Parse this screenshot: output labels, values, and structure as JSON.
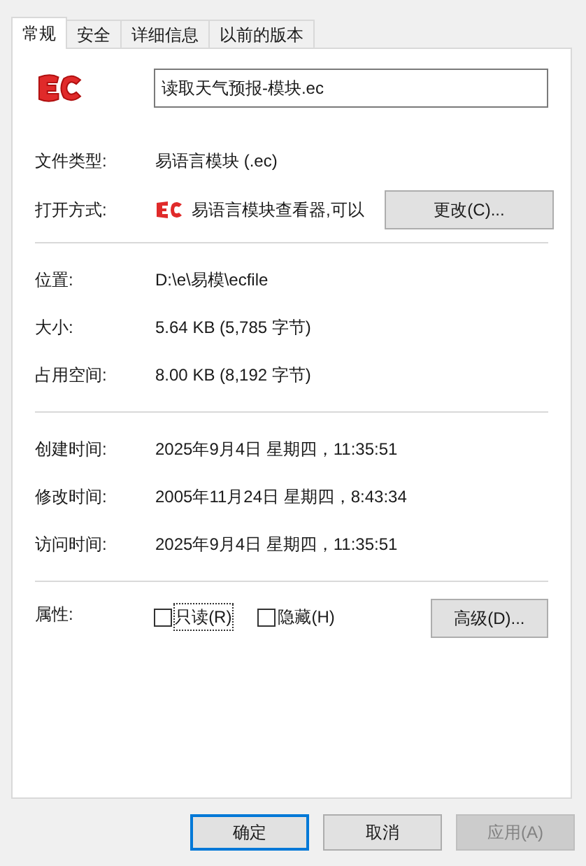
{
  "tabs": [
    {
      "label": "常规",
      "selected": true
    },
    {
      "label": "安全",
      "selected": false
    },
    {
      "label": "详细信息",
      "selected": false
    },
    {
      "label": "以前的版本",
      "selected": false
    }
  ],
  "file_name": "读取天气预报-模块.ec",
  "file_type": {
    "label": "文件类型:",
    "value": "易语言模块 (.ec)"
  },
  "open_with": {
    "label": "打开方式:",
    "value": "易语言模块查看器,可以",
    "button": "更改(C)..."
  },
  "location_group": [
    {
      "label": "位置:",
      "value": "D:\\e\\易模\\ecfile"
    },
    {
      "label": "大小:",
      "value": "5.64 KB (5,785 字节)"
    },
    {
      "label": "占用空间:",
      "value": "8.00 KB (8,192 字节)"
    }
  ],
  "time_group": [
    {
      "label": "创建时间:",
      "value": "2025年9月4日 星期四，11:35:51"
    },
    {
      "label": "修改时间:",
      "value": "2005年11月24日 星期四，8:43:34"
    },
    {
      "label": "访问时间:",
      "value": "2025年9月4日 星期四，11:35:51"
    }
  ],
  "attributes": {
    "label": "属性:",
    "checkboxes": [
      {
        "label": "只读(R)",
        "checked": false,
        "focused": true
      },
      {
        "label": "隐藏(H)",
        "checked": false,
        "focused": false
      }
    ],
    "button": "高级(D)..."
  },
  "buttons": [
    {
      "label": "确定",
      "default": true,
      "disabled": false
    },
    {
      "label": "取消",
      "default": false,
      "disabled": false
    },
    {
      "label": "应用(A)",
      "default": false,
      "disabled": true
    }
  ]
}
